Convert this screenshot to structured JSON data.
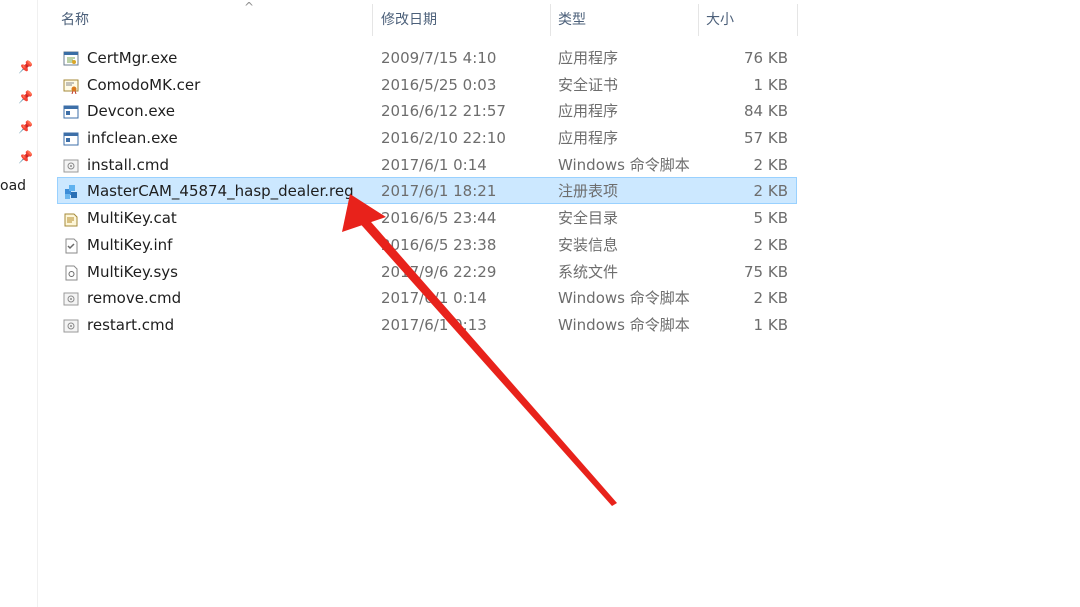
{
  "columns": {
    "name": "名称",
    "date": "修改日期",
    "type": "类型",
    "size": "大小"
  },
  "nav": {
    "partial_label": "oad",
    "pin_icon": "pin-icon"
  },
  "files": [
    {
      "name": "CertMgr.exe",
      "date": "2009/7/15 4:10",
      "type": "应用程序",
      "size": "76 KB",
      "icon": "certmgr-exe-icon"
    },
    {
      "name": "ComodoMK.cer",
      "date": "2016/5/25 0:03",
      "type": "安全证书",
      "size": "1 KB",
      "icon": "certificate-icon"
    },
    {
      "name": "Devcon.exe",
      "date": "2016/6/12 21:57",
      "type": "应用程序",
      "size": "84 KB",
      "icon": "application-icon"
    },
    {
      "name": "infclean.exe",
      "date": "2016/2/10 22:10",
      "type": "应用程序",
      "size": "57 KB",
      "icon": "application-icon"
    },
    {
      "name": "install.cmd",
      "date": "2017/6/1 0:14",
      "type": "Windows 命令脚本",
      "size": "2 KB",
      "icon": "cmd-script-icon"
    },
    {
      "name": "MasterCAM_45874_hasp_dealer.reg",
      "date": "2017/6/1 18:21",
      "type": "注册表项",
      "size": "2 KB",
      "icon": "registry-icon",
      "selected": true
    },
    {
      "name": "MultiKey.cat",
      "date": "2016/6/5 23:44",
      "type": "安全目录",
      "size": "5 KB",
      "icon": "security-catalog-icon"
    },
    {
      "name": "MultiKey.inf",
      "date": "2016/6/5 23:38",
      "type": "安装信息",
      "size": "2 KB",
      "icon": "setup-info-icon"
    },
    {
      "name": "MultiKey.sys",
      "date": "2017/9/6 22:29",
      "type": "系统文件",
      "size": "75 KB",
      "icon": "system-file-icon"
    },
    {
      "name": "remove.cmd",
      "date": "2017/6/1 0:14",
      "type": "Windows 命令脚本",
      "size": "2 KB",
      "icon": "cmd-script-icon"
    },
    {
      "name": "restart.cmd",
      "date": "2017/6/1 0:13",
      "type": "Windows 命令脚本",
      "size": "1 KB",
      "icon": "cmd-script-icon"
    }
  ],
  "colors": {
    "selection_bg": "#cce8ff",
    "selection_border": "#99d1ff",
    "header_text": "#4c607a",
    "annotation_arrow": "#e8221b"
  }
}
